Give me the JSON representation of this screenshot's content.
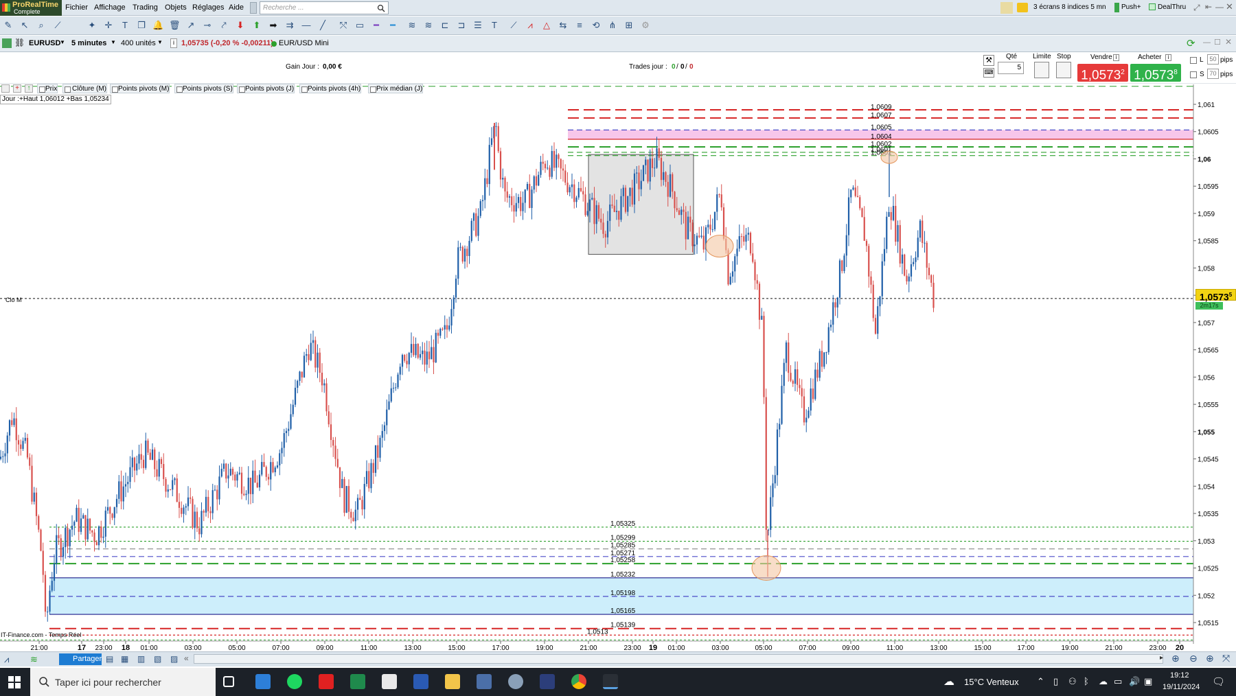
{
  "app": {
    "logo_line1": "ProRealTime",
    "logo_line2": "Complete",
    "menu": [
      "Fichier",
      "Affichage",
      "Trading",
      "Objets",
      "Réglages",
      "Aide"
    ],
    "search_placeholder": "Recherche ...",
    "workspace": "3 écrans 8 indices 5 mn",
    "push": "Push+",
    "dealthru": "DealThru"
  },
  "instrument": {
    "symbol": "EURUSD",
    "timeframe": "5 minutes",
    "units": "400 unités",
    "quote": "1,05735 (-0,20 % -0,00211)",
    "name": "EUR/USD Mini"
  },
  "order": {
    "gain_label": "Gain Jour :",
    "gain_value": "0,00 €",
    "trades_label": "Trades jour :",
    "trades_v1": "0",
    "trades_v2": "0",
    "trades_v3": "0",
    "qty_label": "Qté",
    "qty_value": "5",
    "limit_label": "Limite",
    "stop_label": "Stop",
    "sell_label": "Vendre",
    "buy_label": "Acheter",
    "sell_price_main": "1,0573",
    "sell_price_sup": "2",
    "buy_price_main": "1,0573",
    "buy_price_sup": "8",
    "l_label": "L",
    "l_value": "50",
    "s_label": "S",
    "s_value": "70",
    "pips": "pips"
  },
  "indicators": [
    "Prix",
    "Clôture (M)",
    "Points pivots (M)",
    "Points pivots (S)",
    "Points pivots (J)",
    "Points pivots (4h)",
    "Prix médian (J)"
  ],
  "ohlc_info": "Jour :+Haut 1,06012 +Bas 1,05234",
  "clo_label": "Clo M",
  "source": "IT-Finance.com - Temps Réel",
  "chart_data": {
    "type": "candlestick",
    "symbol": "EURUSD",
    "timeframe": "5 minutes",
    "ylim": [
      1.0511,
      1.0614
    ],
    "y_ticks": [
      "1,061",
      "1,0605",
      "1,06",
      "1,0595",
      "1,059",
      "1,0585",
      "1,058",
      "1,0575",
      "1,057",
      "1,0565",
      "1,056",
      "1,0555",
      "1,055",
      "1,0545",
      "1,054",
      "1,0535",
      "1,053",
      "1,0525",
      "1,052",
      "1,0515"
    ],
    "bold_ticks": [
      "1,06",
      "1,055"
    ],
    "x_ticks": [
      {
        "label": "21:00",
        "bold": false
      },
      {
        "label": "17",
        "bold": true
      },
      {
        "label": "23:00",
        "bold": false
      },
      {
        "label": "18",
        "bold": true
      },
      {
        "label": "01:00",
        "bold": false
      },
      {
        "label": "03:00",
        "bold": false
      },
      {
        "label": "05:00",
        "bold": false
      },
      {
        "label": "07:00",
        "bold": false
      },
      {
        "label": "09:00",
        "bold": false
      },
      {
        "label": "11:00",
        "bold": false
      },
      {
        "label": "13:00",
        "bold": false
      },
      {
        "label": "15:00",
        "bold": false
      },
      {
        "label": "17:00",
        "bold": false
      },
      {
        "label": "19:00",
        "bold": false
      },
      {
        "label": "21:00",
        "bold": false
      },
      {
        "label": "23:00",
        "bold": false
      },
      {
        "label": "19",
        "bold": true
      },
      {
        "label": "01:00",
        "bold": false
      },
      {
        "label": "03:00",
        "bold": false
      },
      {
        "label": "05:00",
        "bold": false
      },
      {
        "label": "07:00",
        "bold": false
      },
      {
        "label": "09:00",
        "bold": false
      },
      {
        "label": "11:00",
        "bold": false
      },
      {
        "label": "13:00",
        "bold": false
      },
      {
        "label": "15:00",
        "bold": false
      },
      {
        "label": "17:00",
        "bold": false
      },
      {
        "label": "19:00",
        "bold": false
      },
      {
        "label": "21:00",
        "bold": false
      },
      {
        "label": "23:00",
        "bold": false
      },
      {
        "label": "20",
        "bold": true
      }
    ],
    "last_price": "1,0573",
    "last_price_sup": "5",
    "countdown": "2m17s",
    "close_m": 1.05744,
    "levels_top": [
      {
        "label": "1,0609",
        "value": 1.0609,
        "color": "#d62424",
        "style": "longdash"
      },
      {
        "label": "1,0607",
        "value": 1.06075,
        "color": "#d62424",
        "style": "longdash"
      },
      {
        "label": "1,0605",
        "value": 1.06053,
        "color": "#4b4bc8",
        "style": "dash"
      },
      {
        "label": "1,0604",
        "value": 1.06036,
        "color": "#d62424",
        "style": "solid"
      },
      {
        "label": "1,0602",
        "value": 1.06022,
        "color": "#2ca02c",
        "style": "longdash"
      },
      {
        "label": "1,0601",
        "value": 1.06012,
        "color": "#2ca02c",
        "style": "dash"
      },
      {
        "label": "1,0601",
        "value": 1.06006,
        "color": "#2ca02c",
        "style": "dash"
      }
    ],
    "levels_bottom": [
      {
        "label": "1,05325",
        "value": 1.05325,
        "color": "#2ca02c",
        "style": "dot"
      },
      {
        "label": "1,05299",
        "value": 1.05299,
        "color": "#2ca02c",
        "style": "dot"
      },
      {
        "label": "1,05285",
        "value": 1.05285,
        "color": "#888888",
        "style": "dash"
      },
      {
        "label": "1,05271",
        "value": 1.05271,
        "color": "#4b4bc8",
        "style": "dash"
      },
      {
        "label": "1,05258",
        "value": 1.05258,
        "color": "#2ca02c",
        "style": "longdash"
      },
      {
        "label": "1,05232",
        "value": 1.05232,
        "color": "#1a1a8a",
        "style": "solid"
      },
      {
        "label": "1,05198",
        "value": 1.05198,
        "color": "#4b4bc8",
        "style": "dash"
      },
      {
        "label": "1,05165",
        "value": 1.05165,
        "color": "#1a1a8a",
        "style": "solid"
      },
      {
        "label": "1,05139",
        "value": 1.05139,
        "color": "#d62424",
        "style": "longdash"
      },
      {
        "label": "1,0513",
        "value": 1.05127,
        "color": "#d62424",
        "style": "dot"
      }
    ],
    "path": [
      [
        0,
        1.0545
      ],
      [
        18,
        1.0553
      ],
      [
        40,
        1.0545
      ],
      [
        60,
        1.0528
      ],
      [
        68,
        1.0517
      ],
      [
        80,
        1.0528
      ],
      [
        110,
        1.0534
      ],
      [
        140,
        1.0531
      ],
      [
        170,
        1.0538
      ],
      [
        210,
        1.0546
      ],
      [
        250,
        1.054
      ],
      [
        290,
        1.0533
      ],
      [
        330,
        1.0543
      ],
      [
        370,
        1.054
      ],
      [
        410,
        1.0547
      ],
      [
        450,
        1.0566
      ],
      [
        470,
        1.056
      ],
      [
        500,
        1.0538
      ],
      [
        520,
        1.0535
      ],
      [
        555,
        1.0548
      ],
      [
        585,
        1.0565
      ],
      [
        620,
        1.0563
      ],
      [
        650,
        1.0568
      ],
      [
        665,
        1.0581
      ],
      [
        700,
        1.059
      ],
      [
        720,
        1.0606
      ],
      [
        735,
        1.0593
      ],
      [
        765,
        1.0592
      ],
      [
        795,
        1.06
      ],
      [
        835,
        1.0595
      ],
      [
        880,
        1.0588
      ],
      [
        920,
        1.0594
      ],
      [
        955,
        1.06
      ],
      [
        980,
        1.0594
      ],
      [
        1000,
        1.0587
      ],
      [
        1025,
        1.0584
      ],
      [
        1050,
        1.0594
      ],
      [
        1060,
        1.0579
      ],
      [
        1080,
        1.0585
      ],
      [
        1095,
        1.0585
      ],
      [
        1110,
        1.0568
      ],
      [
        1118,
        1.0531
      ],
      [
        1125,
        1.054
      ],
      [
        1145,
        1.0565
      ],
      [
        1170,
        1.0553
      ],
      [
        1200,
        1.0565
      ],
      [
        1225,
        1.058
      ],
      [
        1240,
        1.0594
      ],
      [
        1260,
        1.0586
      ],
      [
        1275,
        1.0568
      ],
      [
        1295,
        1.0593
      ],
      [
        1320,
        1.0578
      ],
      [
        1340,
        1.0587
      ],
      [
        1362,
        1.0573
      ]
    ],
    "annotations": [
      {
        "type": "zone",
        "label": "pivot-resistance-zone",
        "y1": 1.06053,
        "y2": 1.06036,
        "color": "#f7c6ea"
      },
      {
        "type": "zone",
        "label": "pivot-support-zone",
        "y1": 1.05232,
        "y2": 1.05165,
        "color": "#cdeefb"
      },
      {
        "type": "rectangle",
        "label": "consolidation-box",
        "x1": 857,
        "x2": 1010,
        "y1": 1.06008,
        "y2": 1.05825,
        "color": "#d9d9d9"
      },
      {
        "type": "ellipse",
        "label": "marker-low",
        "cx": 1116,
        "cy": 1.0525,
        "color": "#f4c7a3"
      },
      {
        "type": "ellipse",
        "label": "marker-mid",
        "cx": 1048,
        "cy": 1.0584,
        "color": "#f4c7a3"
      },
      {
        "type": "ellipse",
        "label": "marker-high",
        "cx": 1295,
        "cy": 1.06003,
        "color": "#f4c7a3"
      }
    ],
    "colors": {
      "up": "#1f5fa8",
      "down": "#d8504d",
      "wick": "#555555"
    }
  },
  "taskbar": {
    "search_text": "Taper ici pour rechercher",
    "weather": "15°C  Venteux",
    "time": "19:12",
    "date": "19/11/2024",
    "share": "Partager"
  }
}
